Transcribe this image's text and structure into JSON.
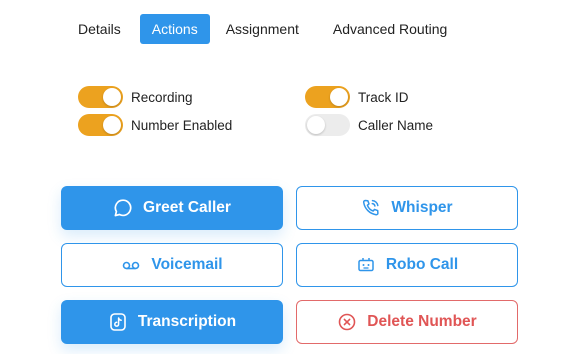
{
  "tabs": [
    {
      "label": "Details",
      "active": false
    },
    {
      "label": "Actions",
      "active": true
    },
    {
      "label": "Assignment",
      "active": false
    },
    {
      "label": "Advanced Routing",
      "active": false
    }
  ],
  "toggles": {
    "recording": {
      "label": "Recording",
      "on": true
    },
    "number_enabled": {
      "label": "Number Enabled",
      "on": true
    },
    "track_id": {
      "label": "Track ID",
      "on": true
    },
    "caller_name": {
      "label": "Caller Name",
      "on": false
    }
  },
  "buttons": {
    "greet_caller": {
      "label": "Greet Caller",
      "icon": "chat-bubble-icon"
    },
    "whisper": {
      "label": "Whisper",
      "icon": "phone-wave-icon"
    },
    "voicemail": {
      "label": "Voicemail",
      "icon": "voicemail-icon"
    },
    "robo_call": {
      "label": "Robo Call",
      "icon": "robot-icon"
    },
    "transcription": {
      "label": "Transcription",
      "icon": "tiktok-icon"
    },
    "delete_number": {
      "label": "Delete Number",
      "icon": "close-circle-icon"
    }
  },
  "colors": {
    "accent": "#2f95ea",
    "toggle_on": "#eca21f",
    "toggle_off": "#ececec",
    "danger": "#e05555"
  }
}
